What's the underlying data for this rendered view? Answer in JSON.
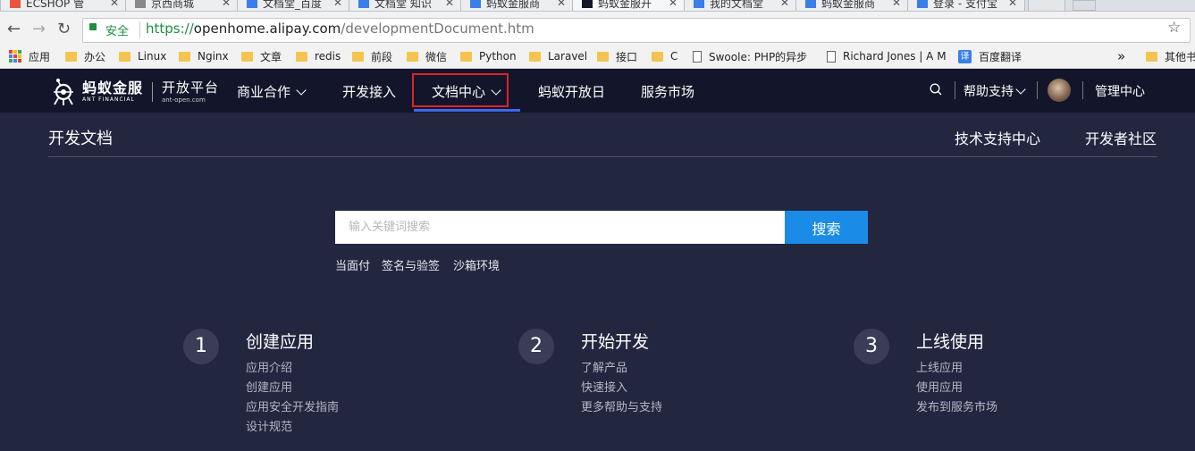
{
  "browser": {
    "tabs": [
      {
        "label": "ECSHOP 管",
        "fav": "#e8553a"
      },
      {
        "label": "京西商城",
        "fav": "#888888"
      },
      {
        "label": "文档堂_百度",
        "fav": "#3a7ee8"
      },
      {
        "label": "文档堂 知识",
        "fav": "#3a7ee8"
      },
      {
        "label": "蚂蚁金服商",
        "fav": "#3a7ee8"
      },
      {
        "label": "蚂蚁金服开",
        "fav": "#13162a"
      },
      {
        "label": "我的文档堂",
        "fav": "#3a7ee8"
      },
      {
        "label": "蚂蚁金服商",
        "fav": "#3a7ee8"
      },
      {
        "label": "登录 - 支付宝",
        "fav": "#3a7ee8"
      }
    ],
    "secure_label": "安全",
    "url_scheme": "https://",
    "url_host": "openhome.alipay.com",
    "url_path": "/developmentDocument.htm",
    "bookmarks": [
      "应用",
      "办公",
      "Linux",
      "Nginx",
      "文章",
      "redis",
      "前段",
      "微信",
      "Python",
      "Laravel",
      "接口",
      "C",
      "Swoole: PHP的异步",
      "Richard Jones | A M",
      "百度翻译"
    ],
    "more_label": "»",
    "other_bookmarks": "其他书"
  },
  "header": {
    "logo_cn": "蚂蚁金服",
    "logo_en": "ANT FINANCIAL",
    "platform_cn": "开放平台",
    "platform_en": "ant-open.com",
    "nav": [
      "商业合作",
      "开发接入",
      "文档中心",
      "蚂蚁开放日",
      "服务市场"
    ],
    "help": "帮助支持",
    "admin": "管理中心"
  },
  "page": {
    "title": "开发文档",
    "links": [
      "技术支持中心",
      "开发者社区"
    ],
    "search_placeholder": "输入关键词搜索",
    "search_button": "搜索",
    "hot_keywords": [
      "当面付",
      "签名与验签",
      "沙箱环境"
    ]
  },
  "steps": [
    {
      "num": "1",
      "title": "创建应用",
      "links": [
        "应用介绍",
        "创建应用",
        "应用安全开发指南",
        "设计规范"
      ]
    },
    {
      "num": "2",
      "title": "开始开发",
      "links": [
        "了解产品",
        "快速接入",
        "更多帮助与支持"
      ]
    },
    {
      "num": "3",
      "title": "上线使用",
      "links": [
        "上线应用",
        "使用应用",
        "发布到服务市场"
      ]
    }
  ]
}
